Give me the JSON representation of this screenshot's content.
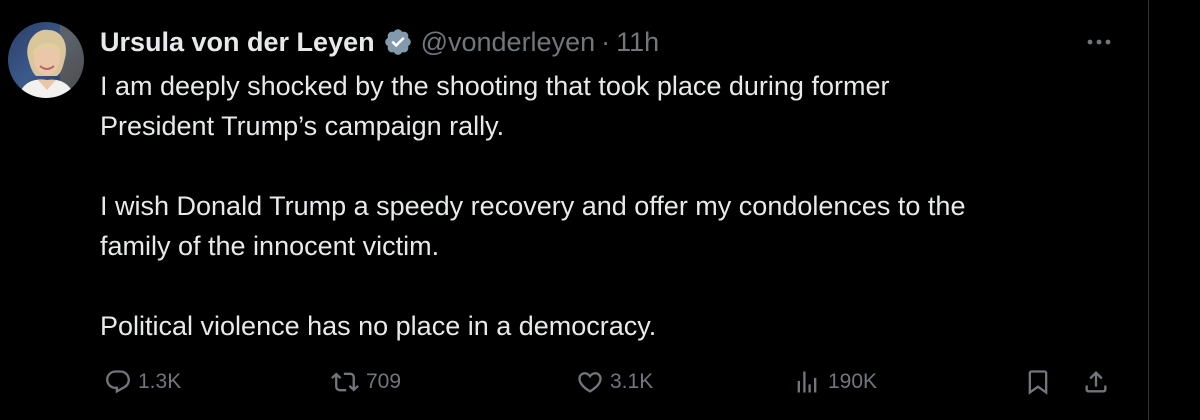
{
  "user": {
    "display_name": "Ursula von der Leyen",
    "handle": "@vonderleyen",
    "separator": "·",
    "time": "11h",
    "avatar_icon": "profile-photo",
    "verified_icon": "verified-badge-icon"
  },
  "tweet": {
    "paragraphs": [
      "I am deeply shocked by the shooting that took place during former President Trump’s campaign rally.",
      "I wish Donald Trump a speedy recovery and offer my condolences to the family of the innocent victim.",
      "Political violence has no place in a democracy."
    ],
    "lines": [
      "I am deeply shocked by the shooting that took place during former",
      "President Trump’s campaign rally.",
      "I wish Donald Trump a speedy recovery and offer my condolences to the",
      "family of the innocent victim.",
      "Political violence has no place in a democracy."
    ]
  },
  "actions": {
    "reply": {
      "icon": "reply-icon",
      "count": "1.3K"
    },
    "repost": {
      "icon": "repost-icon",
      "count": "709"
    },
    "like": {
      "icon": "heart-icon",
      "count": "3.1K"
    },
    "views": {
      "icon": "views-icon",
      "count": "190K"
    },
    "bookmark": {
      "icon": "bookmark-icon"
    },
    "share": {
      "icon": "share-icon"
    },
    "more": {
      "icon": "more-icon"
    }
  },
  "colors": {
    "background": "#000000",
    "text": "#e7e9ea",
    "secondary": "#71767b",
    "verified": "#829aab",
    "border": "#2f3336"
  }
}
